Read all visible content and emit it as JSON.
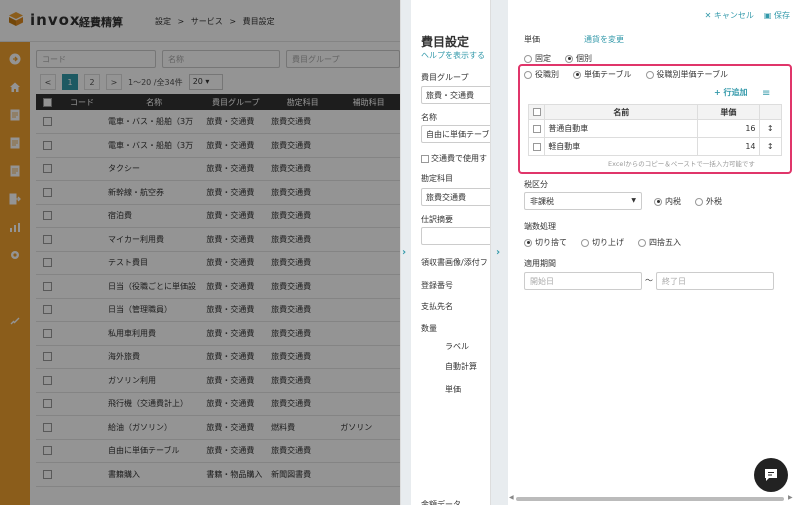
{
  "header": {
    "logo_text": "invox",
    "logo_sub": "経費精算",
    "breadcrumb": [
      "設定",
      ">",
      "サービス",
      ">",
      "費目設定"
    ]
  },
  "list": {
    "filters": {
      "code_placeholder": "コード",
      "name_placeholder": "名称",
      "group_placeholder": "費目グループ"
    },
    "pager": {
      "prev": "<",
      "current": "1",
      "next_page": "2",
      "next": ">",
      "count_text": "1〜20 /全34件",
      "per_page": "20"
    },
    "columns": [
      "",
      "コード",
      "名称",
      "費目グループ",
      "勘定科目",
      "補助科目"
    ],
    "rows": [
      {
        "name": "電車・バス・船舶（3万",
        "group": "旅費・交通費",
        "account": "旅費交通費",
        "sub": ""
      },
      {
        "name": "電車・バス・船舶（3万",
        "group": "旅費・交通費",
        "account": "旅費交通費",
        "sub": ""
      },
      {
        "name": "タクシー",
        "group": "旅費・交通費",
        "account": "旅費交通費",
        "sub": ""
      },
      {
        "name": "新幹線・航空券",
        "group": "旅費・交通費",
        "account": "旅費交通費",
        "sub": ""
      },
      {
        "name": "宿泊費",
        "group": "旅費・交通費",
        "account": "旅費交通費",
        "sub": ""
      },
      {
        "name": "マイカー利用費",
        "group": "旅費・交通費",
        "account": "旅費交通費",
        "sub": ""
      },
      {
        "name": "テスト費目",
        "group": "旅費・交通費",
        "account": "旅費交通費",
        "sub": ""
      },
      {
        "name": "日当（役職ごとに単価設",
        "group": "旅費・交通費",
        "account": "旅費交通費",
        "sub": ""
      },
      {
        "name": "日当（管理職員）",
        "group": "旅費・交通費",
        "account": "旅費交通費",
        "sub": ""
      },
      {
        "name": "私用車利用費",
        "group": "旅費・交通費",
        "account": "旅費交通費",
        "sub": ""
      },
      {
        "name": "海外旅費",
        "group": "旅費・交通費",
        "account": "旅費交通費",
        "sub": ""
      },
      {
        "name": "ガソリン利用",
        "group": "旅費・交通費",
        "account": "旅費交通費",
        "sub": ""
      },
      {
        "name": "飛行機（交通費計上）",
        "group": "旅費・交通費",
        "account": "旅費交通費",
        "sub": ""
      },
      {
        "name": "給油（ガソリン）",
        "group": "旅費・交通費",
        "account": "燃料費",
        "sub": "ガソリン"
      },
      {
        "name": "自由に単価テーブル",
        "group": "旅費・交通費",
        "account": "旅費交通費",
        "sub": ""
      },
      {
        "name": "書籍購入",
        "group": "書籍・物品購入",
        "account": "新聞図書費",
        "sub": ""
      }
    ]
  },
  "middle": {
    "title": "費目設定",
    "help_link": "ヘルプを表示する",
    "group_label": "費目グループ",
    "group_value": "旅費・交通費",
    "name_label": "名称",
    "name_value": "自由に単価テーブ",
    "transport_check": "交通費で使用す",
    "account_label": "勘定科目",
    "account_value": "旅費交通費",
    "journal_label": "仕訳摘要",
    "receipt_label": "領収書画像/添付フ",
    "reg_no_label": "登録番号",
    "payee_label": "支払先名",
    "qty_label": "数量",
    "qty_sub_label": "ラベル",
    "qty_sub_auto": "自動計算",
    "qty_sub_unit": "単価",
    "bottom_cut": "金額データ"
  },
  "right": {
    "cancel": "キャンセル",
    "save": "保存",
    "unit_price_label": "単価",
    "currency_link": "通貨を変更",
    "mode_fixed": "固定",
    "mode_individual": "個別",
    "opt_by_role": "役職別",
    "opt_unit_table": "単価テーブル",
    "opt_role_unit_table": "役職別単価テーブル",
    "add_row": "行追加",
    "table_headers": [
      "",
      "名前",
      "単価",
      ""
    ],
    "table_rows": [
      {
        "name": "普通自動車",
        "price": "16"
      },
      {
        "name": "軽自動車",
        "price": "14"
      }
    ],
    "table_note": "Excelからのコピー＆ペーストで一括入力可能です",
    "tax_label": "税区分",
    "tax_value": "非課税",
    "tax_inclusive": "内税",
    "tax_exclusive": "外税",
    "rounding_label": "端数処理",
    "round_down": "切り捨て",
    "round_up": "切り上げ",
    "round_half": "四捨五入",
    "period_label": "適用期間",
    "start_placeholder": "開始日",
    "end_placeholder": "終了日",
    "tilde": "〜"
  },
  "colors": {
    "accent": "#3399aa",
    "sidebar": "#f0a030",
    "highlight": "#e0356a"
  }
}
